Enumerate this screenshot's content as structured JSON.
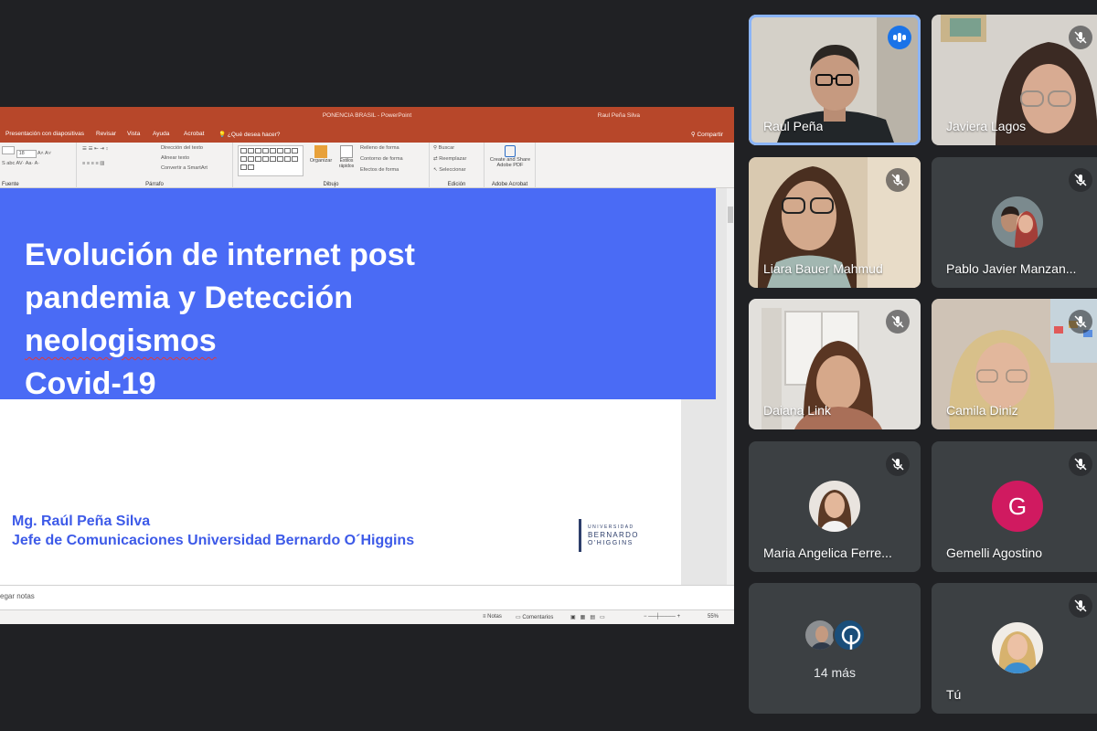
{
  "powerpoint": {
    "document_title": "PONENCIA BRASIL  -  PowerPoint",
    "user_name": "Raul Peña Silva",
    "share_label": "Compartir",
    "tabs": [
      "Presentación con diapositivas",
      "Revisar",
      "Vista",
      "Ayuda",
      "Acrobat",
      "¿Qué desea hacer?"
    ],
    "ribbon": {
      "font_group": "Fuente",
      "font_size": "18",
      "paragraph_group": "Párrafo",
      "paragraph_items": [
        "Dirección del texto",
        "Alinear texto",
        "Convertir a SmartArt"
      ],
      "drawing_group": "Dibujo",
      "organize": "Organizar",
      "quick_styles": "Estilos rápidos",
      "shape_items": [
        "Relleno de forma",
        "Contorno de forma",
        "Efectos de forma"
      ],
      "editing_group": "Edición",
      "editing_items": [
        "Buscar",
        "Reemplazar",
        "Seleccionar"
      ],
      "acrobat_group": "Adobe Acrobat",
      "acrobat_button": "Create and Share Adobe PDF"
    },
    "slide": {
      "title_lines": [
        "Evolución de internet post",
        "pandemia y Detección",
        "neologismos",
        "Covid-19"
      ],
      "author_line1": "Mg. Raúl Peña Silva",
      "author_line2": "Jefe de Comunicaciones Universidad Bernardo O´Higgins",
      "logo_top": "UNIVERSIDAD",
      "logo_mid": "BERNARDO",
      "logo_bottom": "O'HIGGINS"
    },
    "notes_placeholder": "egar notas",
    "status": {
      "notes": "Notas",
      "comments": "Comentarios",
      "zoom": "55%"
    }
  },
  "participants": [
    {
      "name": "Raul Peña",
      "speaking": true
    },
    {
      "name": "Javiera Lagos",
      "muted": true
    },
    {
      "name": "Liara Bauer Mahmud",
      "muted": true
    },
    {
      "name": "Pablo Javier Manzan...",
      "muted": true
    },
    {
      "name": "Daiana Link",
      "muted": true
    },
    {
      "name": "Camila Diniz",
      "muted": true
    },
    {
      "name": "Maria Angelica Ferre...",
      "muted": true
    },
    {
      "name": "Gemelli Agostino",
      "muted": true,
      "initial": "G"
    },
    {
      "name": "14 más"
    },
    {
      "name": "Tú",
      "muted": true
    }
  ],
  "colors": {
    "background": "#202124",
    "tile": "#3c4043",
    "powerpoint_accent": "#b7472a",
    "slide_banner": "#4a6bf5",
    "speaking_border": "#8ab4f8",
    "gemelli_avatar": "#d01a60"
  }
}
